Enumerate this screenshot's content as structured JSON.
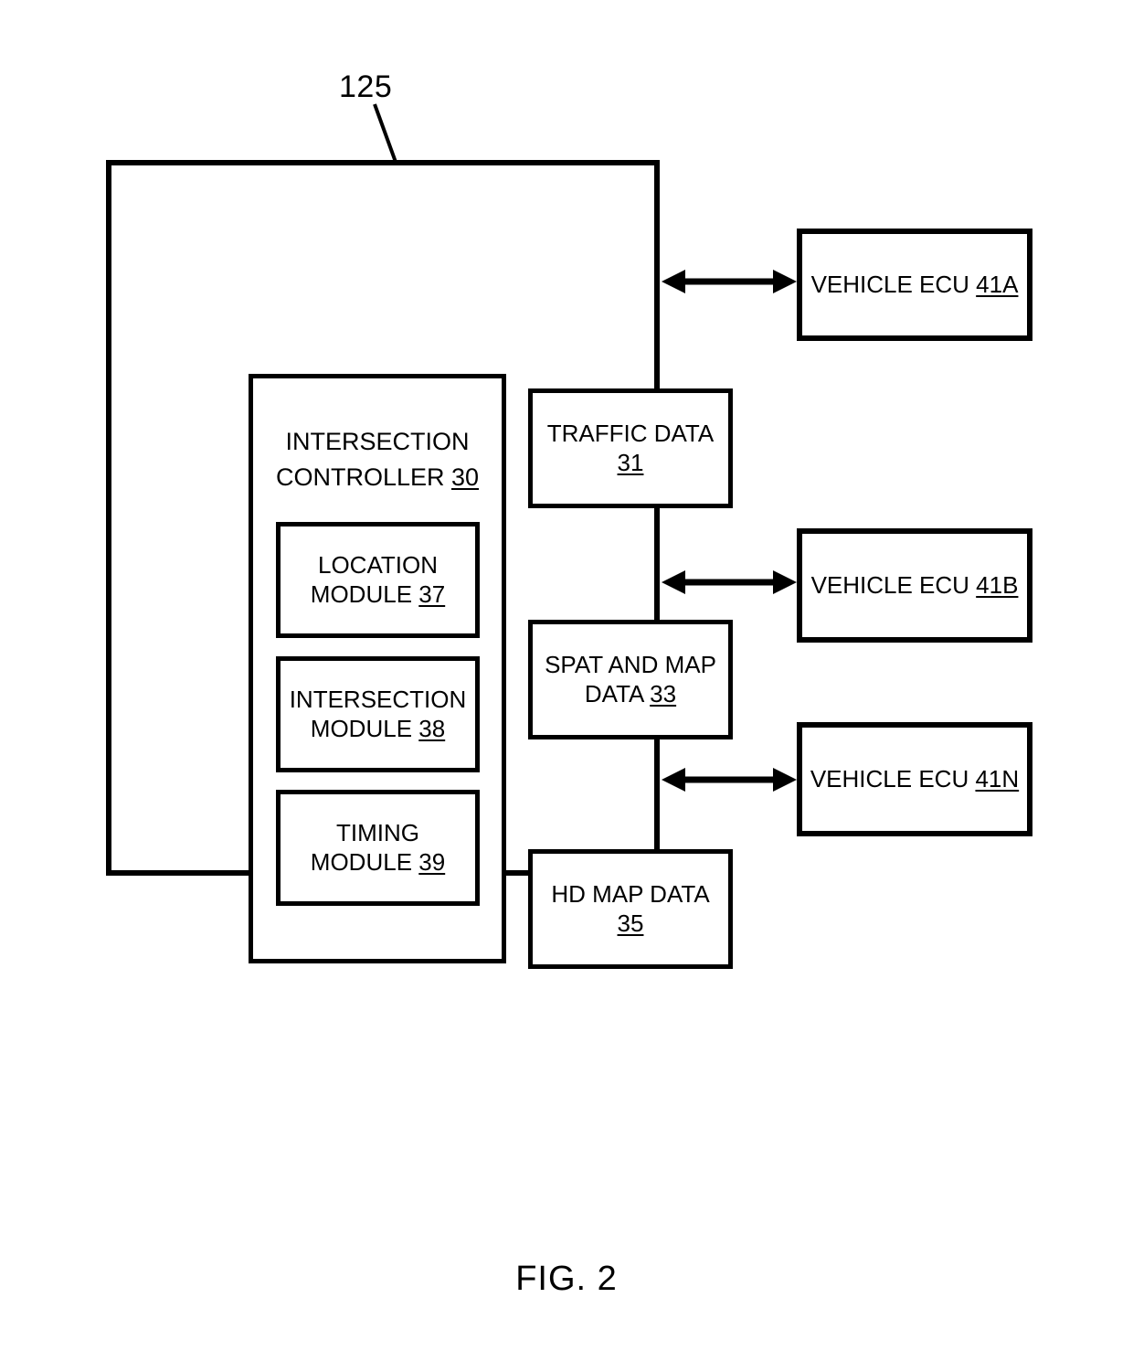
{
  "figure": {
    "caption": "FIG. 2",
    "callout_number": "125"
  },
  "system": {
    "controller": {
      "title_line1": "INTERSECTION",
      "title_line2": "CONTROLLER ",
      "ref": "30",
      "modules": [
        {
          "line1": "LOCATION",
          "line2": "MODULE ",
          "ref": "37",
          "name": "location-module"
        },
        {
          "line1": "INTERSECTION",
          "line2": "MODULE ",
          "ref": "38",
          "name": "intersection-module"
        },
        {
          "line1": "TIMING",
          "line2": "MODULE ",
          "ref": "39",
          "name": "timing-module"
        }
      ]
    },
    "data_stores": [
      {
        "line1": "TRAFFIC DATA",
        "line2": "",
        "ref": "31",
        "name": "traffic-data"
      },
      {
        "line1": "SPAT AND MAP",
        "line2": "DATA ",
        "ref": "33",
        "name": "spat-and-map-data"
      },
      {
        "line1": "HD MAP DATA",
        "line2": "",
        "ref": "35",
        "name": "hd-map-data"
      }
    ]
  },
  "vehicle_ecus": [
    {
      "label": "VEHICLE ECU ",
      "ref": "41A",
      "name": "vehicle-ecu-41a"
    },
    {
      "label": "VEHICLE ECU ",
      "ref": "41B",
      "name": "vehicle-ecu-41b"
    },
    {
      "label": "VEHICLE ECU ",
      "ref": "41N",
      "name": "vehicle-ecu-41n"
    }
  ],
  "connectors": [
    {
      "from": "system-125",
      "to": "vehicle-ecu-41a",
      "style": "double-arrow"
    },
    {
      "from": "system-125",
      "to": "vehicle-ecu-41b",
      "style": "double-arrow"
    },
    {
      "from": "system-125",
      "to": "vehicle-ecu-41n",
      "style": "double-arrow"
    }
  ],
  "colors": {
    "stroke": "#000000",
    "background": "#ffffff"
  }
}
